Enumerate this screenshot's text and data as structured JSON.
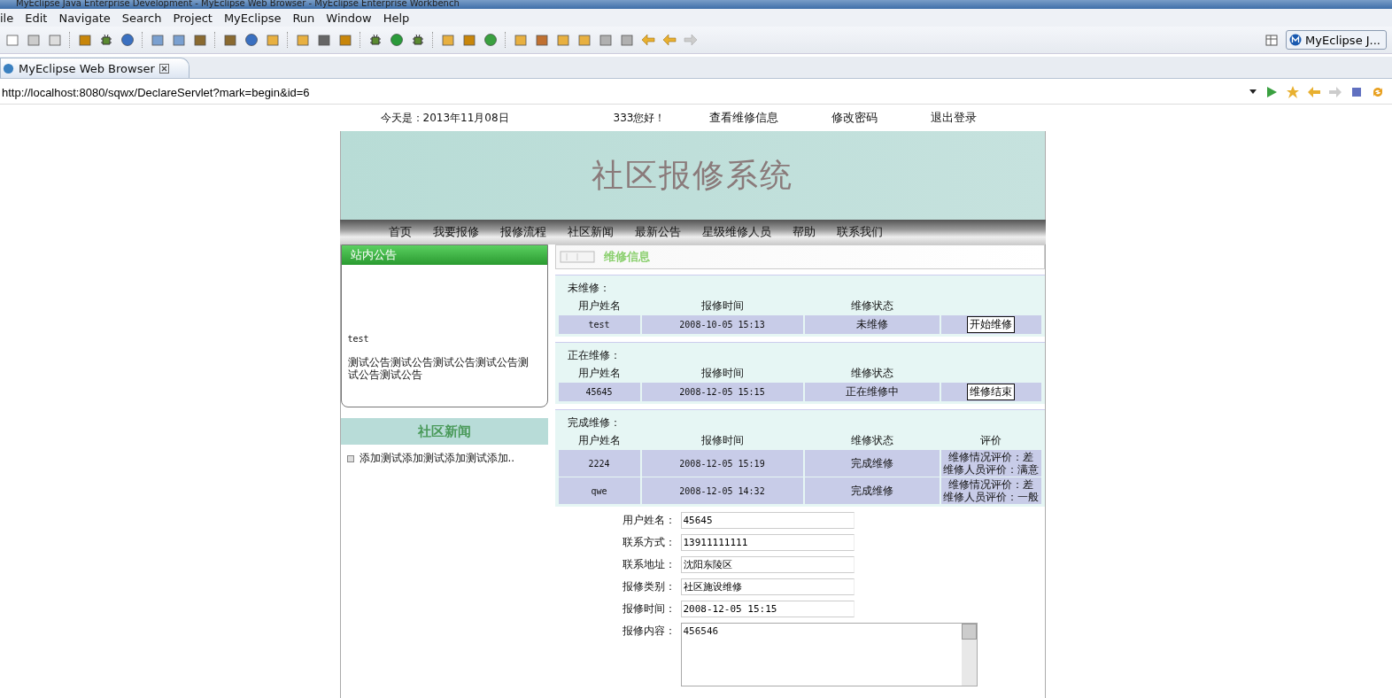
{
  "window": {
    "title": "MyEclipse Java Enterprise Development - MyEclipse Web Browser - MyEclipse Enterprise Workbench"
  },
  "menu": [
    "ile",
    "Edit",
    "Navigate",
    "Search",
    "Project",
    "MyEclipse",
    "Run",
    "Window",
    "Help"
  ],
  "perspective": {
    "label": "MyEclipse J..."
  },
  "editor_tab": {
    "label": "MyEclipse Web Browser",
    "selected": true
  },
  "address_bar": {
    "value": "http://localhost:8080/sqwx/DeclareServlet?mark=begin&id=6"
  },
  "page": {
    "top_bar": [
      {
        "kind": "text",
        "label": "今天是：2013年11月08日"
      },
      {
        "kind": "text",
        "label": "333您好！"
      },
      {
        "kind": "link",
        "label": "查看维修信息"
      },
      {
        "kind": "link",
        "label": "修改密码"
      },
      {
        "kind": "link",
        "label": "退出登录"
      }
    ],
    "banner": {
      "title": "社区报修系统"
    },
    "nav": [
      "首页",
      "我要报修",
      "报修流程",
      "社区新闻",
      "最新公告",
      "星级维修人员",
      "帮助",
      "联系我们"
    ],
    "notice_panel": {
      "title": "站内公告",
      "author": "test",
      "text": "测试公告测试公告测试公告测试公告测试公告测试公告"
    },
    "news_panel": {
      "title": "社区新闻",
      "items": [
        "添加测试添加测试添加测试添加.."
      ]
    },
    "repair_panel": {
      "title": "维修信息",
      "sections": [
        {
          "title": "未维修：",
          "columns": [
            "用户姓名",
            "报修时间",
            "维修状态",
            ""
          ],
          "rows": [
            {
              "cells": [
                "test",
                "2008-10-05 15:13",
                "未维修"
              ],
              "action": "开始维修"
            }
          ]
        },
        {
          "title": "正在维修：",
          "columns": [
            "用户姓名",
            "报修时间",
            "维修状态",
            ""
          ],
          "rows": [
            {
              "cells": [
                "45645",
                "2008-12-05 15:15",
                "正在维修中"
              ],
              "action": "维修结束"
            }
          ]
        },
        {
          "title": "完成维修：",
          "columns": [
            "用户姓名",
            "报修时间",
            "维修状态",
            "评价"
          ],
          "rows": [
            {
              "cells": [
                "2224",
                "2008-12-05 15:19",
                "完成维修"
              ],
              "evaluation": [
                "维修情况评价：差",
                "维修人员评价：满意"
              ]
            },
            {
              "cells": [
                "qwe",
                "2008-12-05 14:32",
                "完成维修"
              ],
              "evaluation": [
                "维修情况评价：差",
                "维修人员评价：一般"
              ]
            }
          ]
        }
      ]
    },
    "form": [
      {
        "kind": "input",
        "label": "用户姓名：",
        "value": "45645"
      },
      {
        "kind": "input",
        "label": "联系方式：",
        "value": "13911111111"
      },
      {
        "kind": "input",
        "label": "联系地址：",
        "value": "沈阳东陵区"
      },
      {
        "kind": "input",
        "label": "报修类别：",
        "value": "社区施设维修"
      },
      {
        "kind": "input",
        "label": "报修时间：",
        "value": "2008-12-05 15:15"
      },
      {
        "kind": "textarea",
        "label": "报修内容：",
        "value": "456546"
      }
    ]
  }
}
